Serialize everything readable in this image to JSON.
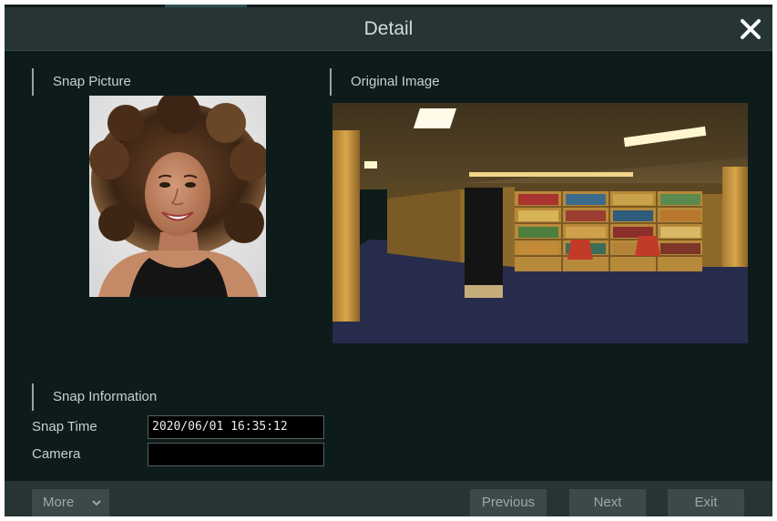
{
  "dialog": {
    "title": "Detail",
    "close_icon": "close-icon"
  },
  "sections": {
    "snap_picture": "Snap Picture",
    "original_image": "Original Image",
    "snap_information": "Snap Information"
  },
  "info": {
    "snap_time_label": "Snap Time",
    "snap_time_value": "2020/06/01 16:35:12",
    "camera_label": "Camera",
    "camera_value": ""
  },
  "footer": {
    "more_label": "More",
    "more_icon": "chevron-down-icon",
    "previous_label": "Previous",
    "next_label": "Next",
    "exit_label": "Exit"
  },
  "colors": {
    "dialog_bg": "#0e1b1b",
    "bar_bg": "#263434",
    "text": "#c8cfcf",
    "button_bg": "#3c4949"
  }
}
